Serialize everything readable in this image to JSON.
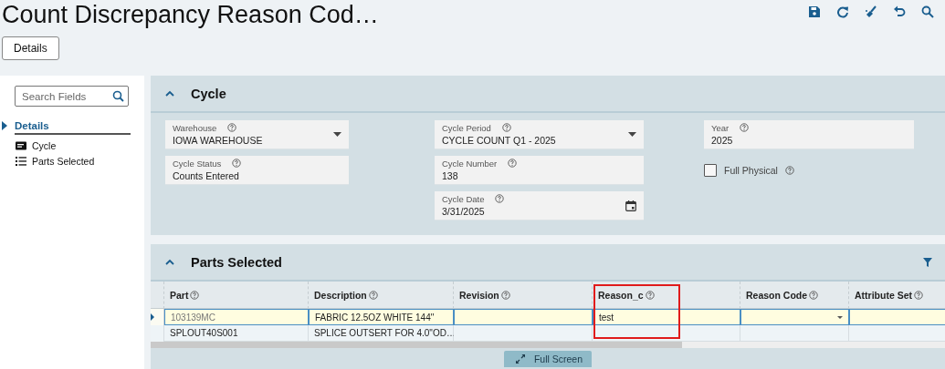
{
  "title": "Count Discrepancy Reason Cod…",
  "toolbar": [
    {
      "kind": "save"
    },
    {
      "kind": "refresh"
    },
    {
      "kind": "clear"
    },
    {
      "kind": "undo"
    },
    {
      "kind": "search"
    }
  ],
  "tabs": [
    {
      "label": "Details",
      "selected": true
    }
  ],
  "sidebar": {
    "search": {
      "placeholder": "Search Fields"
    },
    "items": [
      {
        "label": "Details",
        "selected": true,
        "children": [
          {
            "label": "Cycle",
            "kind": "card"
          },
          {
            "label": "Parts Selected",
            "kind": "list"
          }
        ]
      }
    ]
  },
  "cycle": {
    "title": "Cycle",
    "expanded": true,
    "columns": [
      [
        {
          "kind": "select",
          "label": "Warehouse",
          "value": "IOWA WAREHOUSE"
        },
        {
          "kind": "text",
          "label": "Cycle Status",
          "value": "Counts Entered"
        }
      ],
      [
        {
          "kind": "select",
          "label": "Cycle Period",
          "value": "CYCLE COUNT Q1 - 2025"
        },
        {
          "kind": "text",
          "label": "Cycle Number",
          "value": "138"
        },
        {
          "kind": "date",
          "label": "Cycle Date",
          "value": "3/31/2025"
        }
      ],
      [
        {
          "kind": "text",
          "label": "Year",
          "value": "2025"
        },
        {
          "kind": "checkbox",
          "label": "Full Physical",
          "checked": false
        }
      ]
    ]
  },
  "parts_selected": {
    "title": "Parts Selected",
    "expanded": true,
    "columns": [
      {
        "label": "Part",
        "kind": "text",
        "highlighted": false
      },
      {
        "label": "Description",
        "kind": "text",
        "highlighted": false
      },
      {
        "label": "Revision",
        "kind": "text",
        "highlighted": false
      },
      {
        "label": "Reason_c",
        "kind": "text",
        "highlighted": true
      },
      {
        "label": "Reason Code",
        "kind": "dropdown",
        "highlighted": false
      },
      {
        "label": "Attribute Set",
        "kind": "text",
        "highlighted": false
      }
    ],
    "rows": [
      {
        "selected": true,
        "cells": [
          "103139MC",
          "FABRIC 12.5OZ WHITE 144\"",
          "",
          "test",
          "",
          ""
        ]
      },
      {
        "selected": false,
        "cells": [
          "SPLOUT40S001",
          "SPLICE OUTSERT FOR 4.0\"OD…",
          "",
          "",
          "",
          ""
        ]
      }
    ],
    "full_screen_button": "Full Screen"
  }
}
